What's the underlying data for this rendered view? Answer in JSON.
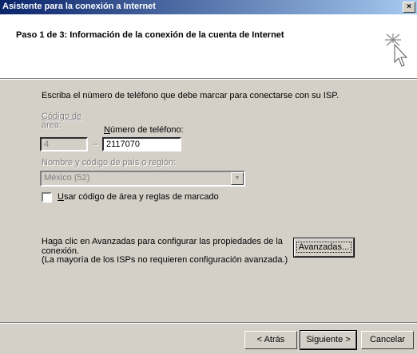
{
  "window": {
    "title": "Asistente para la conexión a Internet",
    "close_label": "×"
  },
  "header": {
    "step": "Paso 1 de 3: Información de la conexión de la cuenta de Internet"
  },
  "content": {
    "instructions": "Escriba el número de teléfono que debe marcar para conectarse con su ISP.",
    "area_code_label_line1": "Código de",
    "area_code_label_line2": "área:",
    "area_code_value": "4",
    "dash": "–",
    "phone_label": "Número de teléfono:",
    "phone_value": "2117070",
    "country_label": "Nombre y código de país o región:",
    "country_value": "México (52)",
    "use_area_code_label": "Usar código de área y reglas de marcado",
    "use_area_code_checked": false,
    "advanced_text_line1": "Haga clic en Avanzadas para configurar las propiedades de la",
    "advanced_text_line2": "conexión.",
    "advanced_text_line3": "(La mayoría de los ISPs no requieren configuración avanzada.)",
    "advanced_button": "Avanzadas..."
  },
  "footer": {
    "back_button": "< Atrás",
    "next_button": "Siguiente >",
    "cancel_button": "Cancelar"
  },
  "icons": {
    "wizard": "wizard-cursor-icon",
    "dropdown": "chevron-down-icon"
  }
}
